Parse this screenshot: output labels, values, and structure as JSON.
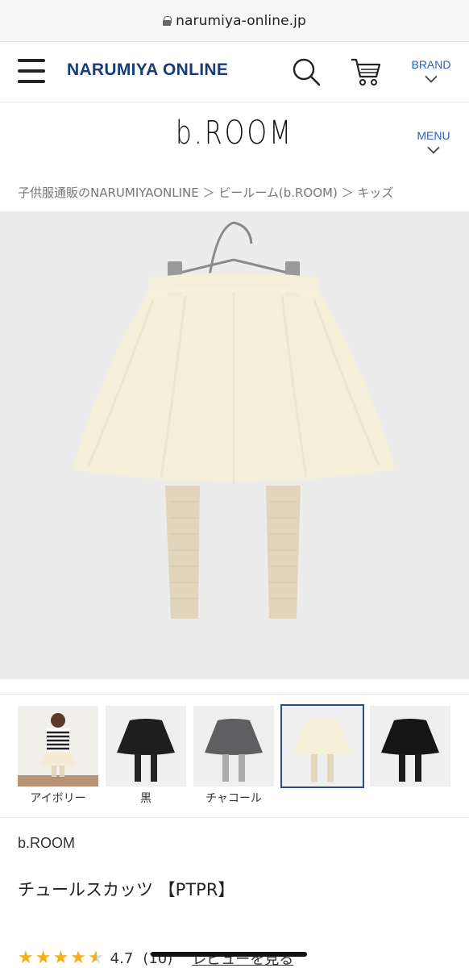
{
  "browser": {
    "url": "narumiya-online.jp"
  },
  "header": {
    "logo": "NARUMIYA ONLINE",
    "brand_label": "BRAND"
  },
  "shop": {
    "logo": "b.ROOM",
    "menu_label": "MENU"
  },
  "breadcrumb": "子供服通販のNARUMIYAONLINE ＞ ビールーム(b.ROOM) ＞ キッズ",
  "thumbnails": [
    {
      "label": "アイボリー",
      "color": "ivory-model"
    },
    {
      "label": "黒",
      "color": "black"
    },
    {
      "label": "チャコール",
      "color": "charcoal"
    },
    {
      "label": "",
      "color": "ivory",
      "selected": true
    },
    {
      "label": "",
      "color": "black"
    }
  ],
  "product": {
    "shop_name": "b.ROOM",
    "name": "チュールスカッツ 【PTPR】",
    "rating": "4.7",
    "rating_count": "(10)",
    "review_link": "レビューを見る",
    "stars": 4.5
  },
  "colors": {
    "brand_navy": "#173c79",
    "link_blue": "#2a5fbf",
    "star": "#f2b01e",
    "selected_border": "#2a4c8c"
  }
}
